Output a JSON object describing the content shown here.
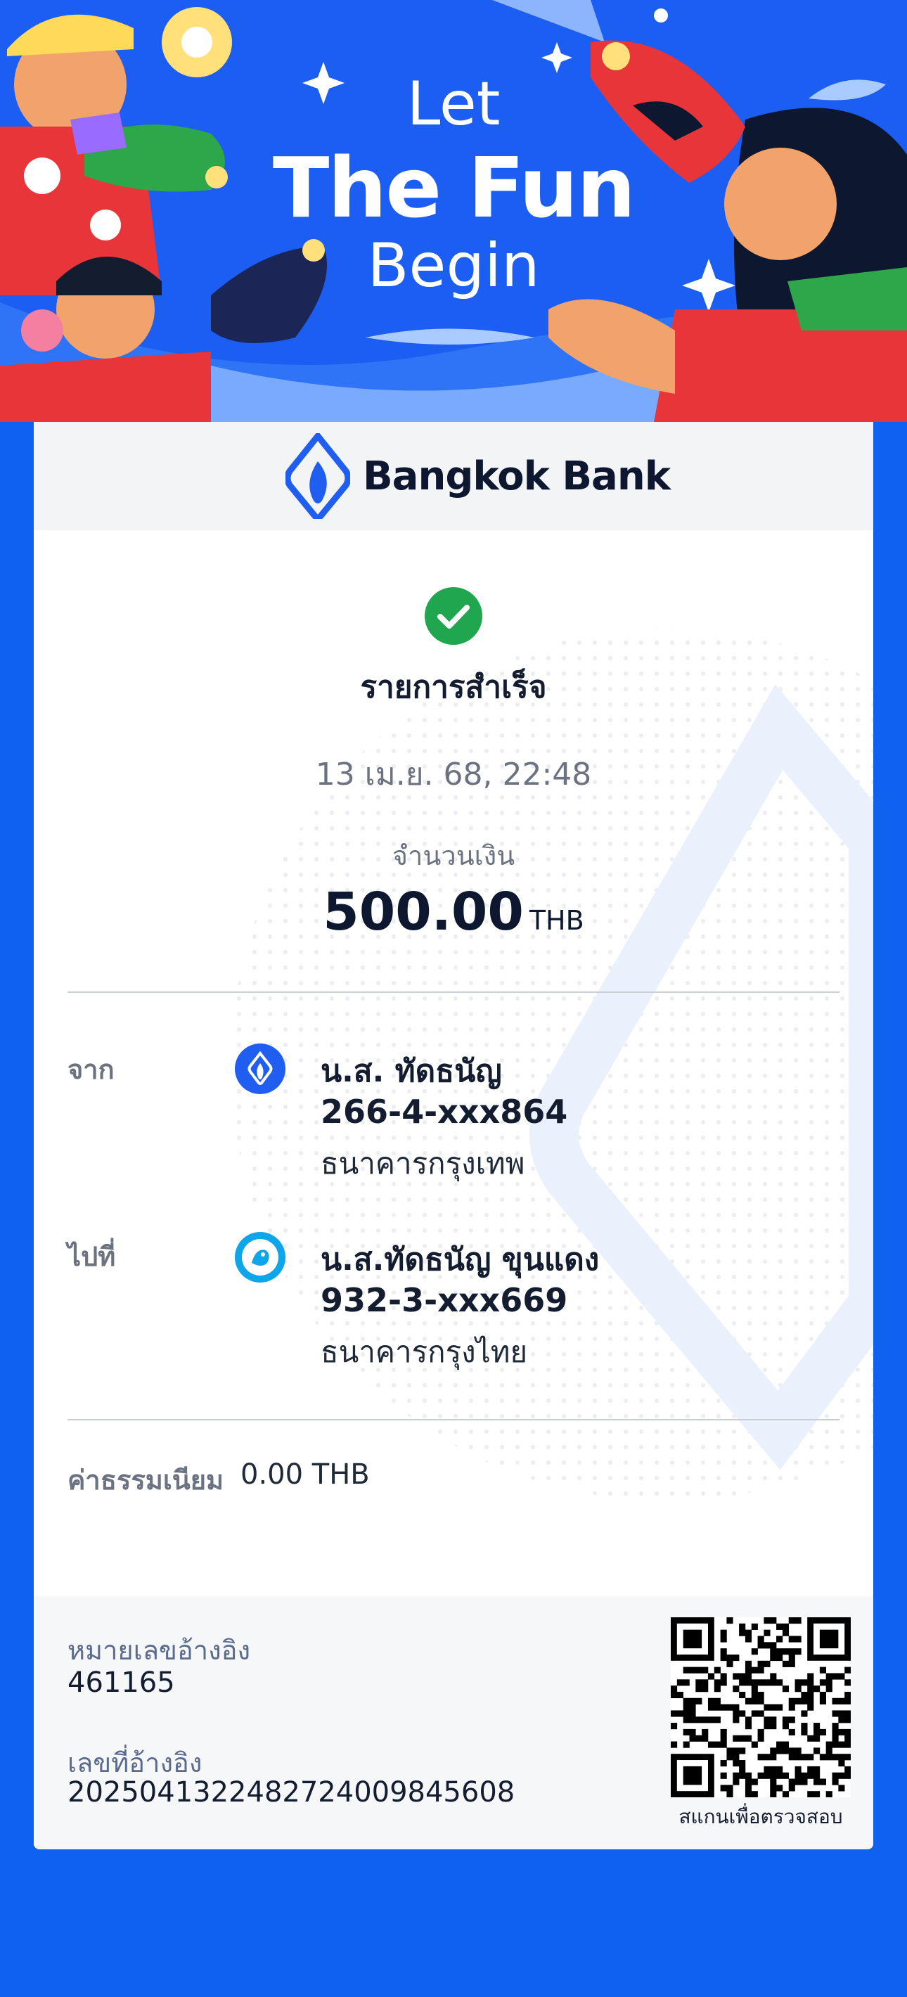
{
  "banner": {
    "line1": "Let",
    "line2": "The Fun",
    "line3": "Begin"
  },
  "header": {
    "brand": "Bangkok Bank"
  },
  "status": {
    "text": "รายการสำเร็จ",
    "datetime": "13 เม.ย. 68, 22:48"
  },
  "amount": {
    "label": "จำนวนเงิน",
    "value": "500.00",
    "currency": "THB"
  },
  "from": {
    "label": "จาก",
    "name": "น.ส. ทัดธนัญ",
    "account": "266-4-xxx864",
    "bank": "ธนาคารกรุงเทพ",
    "icon": "bangkok-bank-icon"
  },
  "to": {
    "label": "ไปที่",
    "name": "น.ส.ทัดธนัญ ขุนแดง",
    "account": "932-3-xxx669",
    "bank": "ธนาคารกรุงไทย",
    "icon": "krungthai-bank-icon"
  },
  "fee": {
    "label": "ค่าธรรมเนียม",
    "value": "0.00 THB"
  },
  "reference": {
    "label1": "หมายเลขอ้างอิง",
    "value1": "461165",
    "label2": "เลขที่อ้างอิง",
    "value2": "20250413224827240098456​08"
  },
  "qr": {
    "caption": "สแกนเพื่อตรวจสอบ"
  },
  "colors": {
    "brand_blue": "#0f62f0",
    "success_green": "#1fa64f",
    "text_dark": "#141c30"
  }
}
